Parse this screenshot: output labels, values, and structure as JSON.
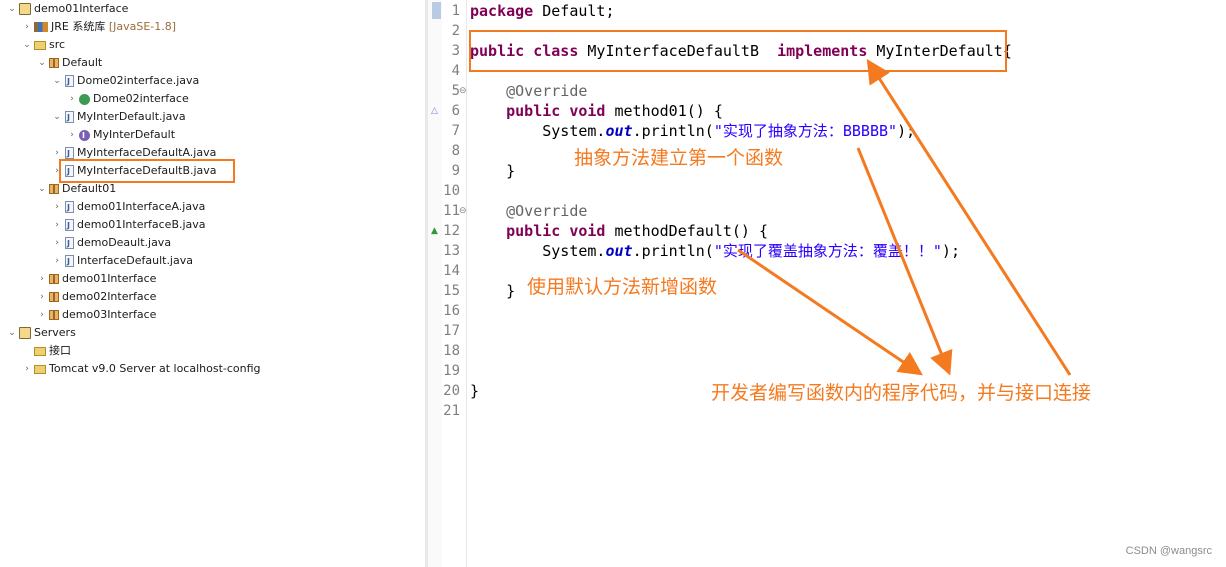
{
  "explorer": {
    "items": [
      {
        "label": "demo01Interface",
        "icon": "project-icon",
        "twisty": "expanded"
      },
      {
        "label": "JRE 系统库",
        "tag": "[JavaSE-1.8]",
        "icon": "library-icon",
        "twisty": "collapsed"
      },
      {
        "label": "src",
        "icon": "source-folder-icon",
        "twisty": "expanded"
      },
      {
        "label": "Default",
        "icon": "package-icon",
        "twisty": "expanded"
      },
      {
        "label": "Dome02interface.java",
        "icon": "java-file-icon",
        "twisty": "expanded"
      },
      {
        "label": "Dome02interface",
        "icon": "class-icon",
        "twisty": "collapsed"
      },
      {
        "label": "MyInterDefault.java",
        "icon": "java-file-icon",
        "twisty": "expanded"
      },
      {
        "label": "MyInterDefault",
        "icon": "interface-icon",
        "twisty": "collapsed"
      },
      {
        "label": "MyInterfaceDefaultA.java",
        "icon": "java-file-icon",
        "twisty": "collapsed"
      },
      {
        "label": "MyInterfaceDefaultB.java",
        "icon": "java-file-icon",
        "twisty": "collapsed"
      },
      {
        "label": "Default01",
        "icon": "package-icon",
        "twisty": "expanded"
      },
      {
        "label": "demo01InterfaceA.java",
        "icon": "java-file-icon",
        "twisty": "collapsed"
      },
      {
        "label": "demo01InterfaceB.java",
        "icon": "java-file-icon",
        "twisty": "collapsed"
      },
      {
        "label": "demoDeault.java",
        "icon": "java-file-icon",
        "twisty": "collapsed"
      },
      {
        "label": "InterfaceDefault.java",
        "icon": "java-file-icon",
        "twisty": "collapsed"
      },
      {
        "label": "demo01Interface",
        "icon": "package-icon",
        "twisty": "collapsed"
      },
      {
        "label": "demo02Interface",
        "icon": "package-icon",
        "twisty": "collapsed"
      },
      {
        "label": "demo03Interface",
        "icon": "package-icon",
        "twisty": "collapsed"
      },
      {
        "label": "Servers",
        "icon": "project-icon",
        "twisty": "expanded"
      },
      {
        "label": "接口",
        "icon": "folder-icon",
        "twisty": "none"
      },
      {
        "label": "Tomcat v9.0 Server at localhost-config",
        "icon": "folder-icon",
        "twisty": "collapsed"
      }
    ]
  },
  "editor": {
    "line_numbers": [
      "1",
      "2",
      "3",
      "4",
      "5",
      "6",
      "7",
      "8",
      "9",
      "10",
      "11",
      "12",
      "13",
      "14",
      "15",
      "16",
      "17",
      "18",
      "19",
      "20",
      "21"
    ],
    "code": {
      "l1_kw": "package",
      "l1_rest": " Default;",
      "l3_kw1": "public",
      "l3_kw2": "class",
      "l3_name": " MyInterfaceDefaultB  ",
      "l3_kw3": "implements",
      "l3_rest": " MyInterDefault{",
      "override": "@Override",
      "l6_kw1": "public",
      "l6_kw2": "void",
      "l6_rest": " method01() {",
      "l7_pre": "System.",
      "l7_out": "out",
      "l7_mid": ".println(",
      "l7_str": "\"实现了抽象方法：BBBBB\"",
      "l7_end": ");",
      "close_brace": "}",
      "l12_kw1": "public",
      "l12_kw2": "void",
      "l12_rest": " methodDefault() {",
      "l13_pre": "System.",
      "l13_out": "out",
      "l13_mid": ".println(",
      "l13_str": "\"实现了覆盖抽象方法：覆盖！！\"",
      "l13_end": ");",
      "end_brace": "}"
    }
  },
  "annotations": {
    "note1": "抽象方法建立第一个函数",
    "note2": "使用默认方法新增函数",
    "note3": "开发者编写函数内的程序代码，并与接口连接",
    "color": "#f47a20"
  },
  "watermark": "CSDN @wangsrc"
}
